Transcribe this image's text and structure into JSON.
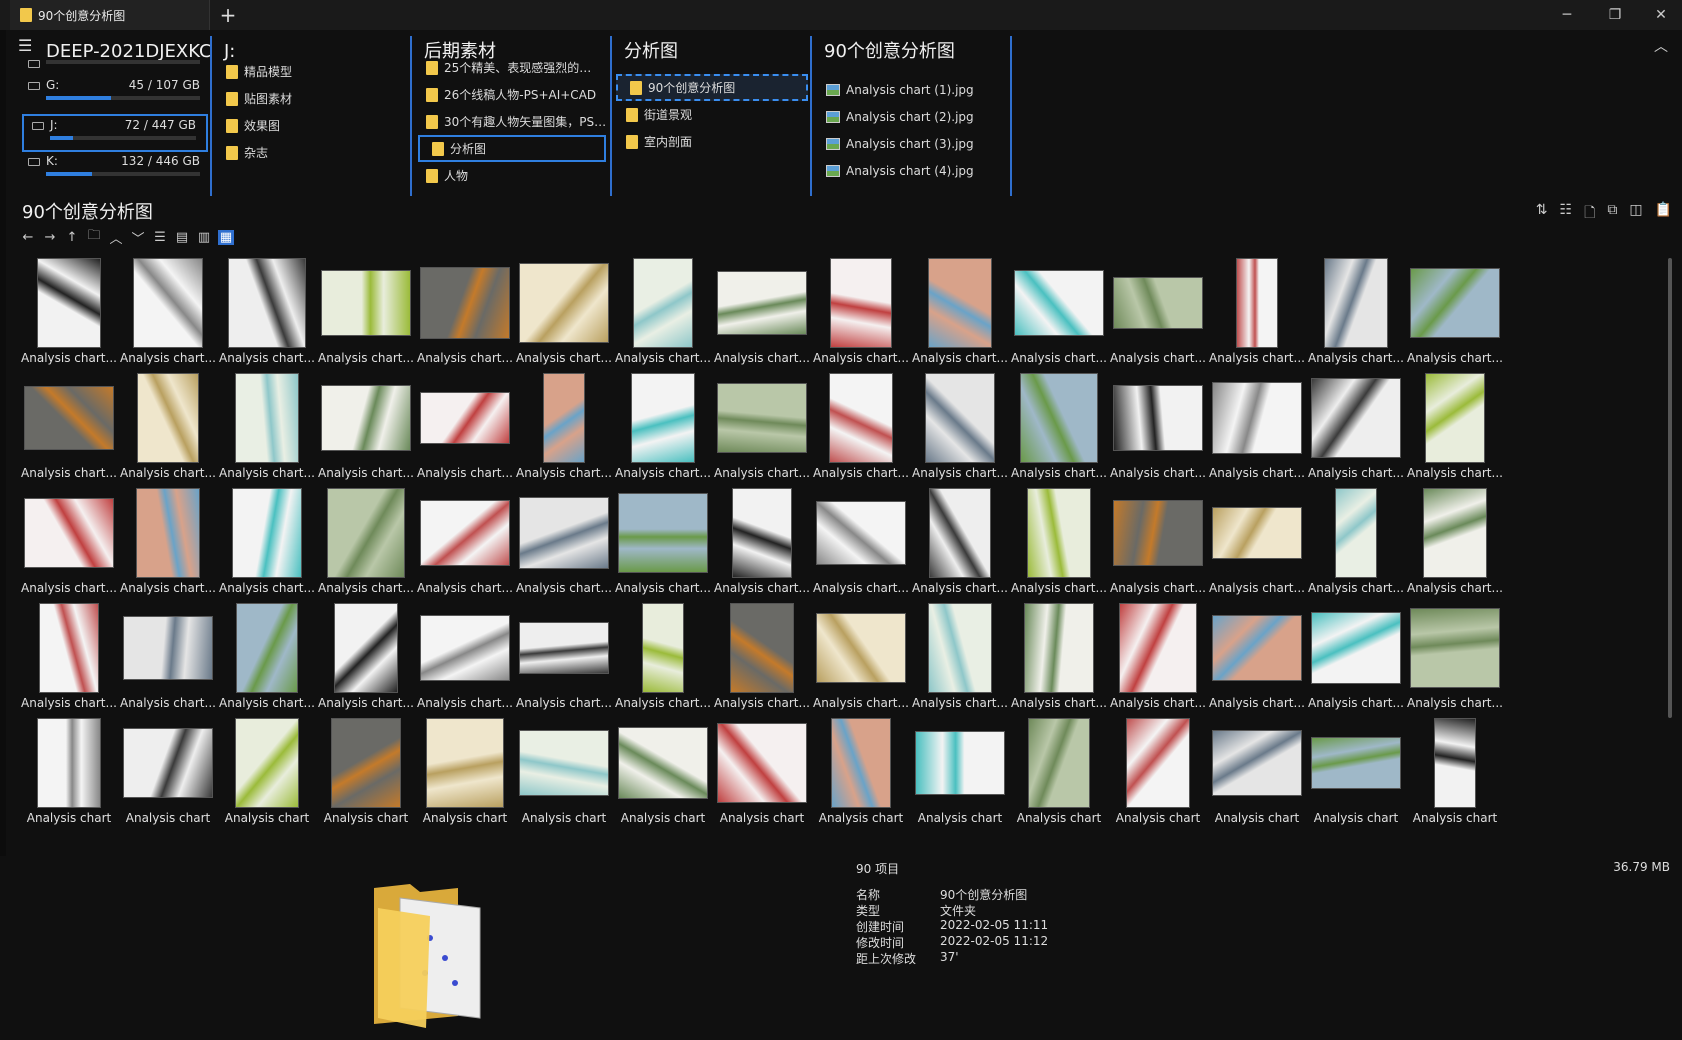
{
  "window": {
    "tab_title": "90个创意分析图",
    "new_tab": "+",
    "minimize": "─",
    "maximize": "❐",
    "close": "✕"
  },
  "columns": {
    "drives_title": "DEEP-2021DJEXKC",
    "drives": [
      {
        "label": "",
        "value": "",
        "fill": 0.0
      },
      {
        "label": "G:",
        "value": "45 / 107 GB",
        "fill": 0.42
      },
      {
        "label": "J:",
        "value": "72 / 447 GB",
        "fill": 0.16,
        "selected": true
      },
      {
        "label": "K:",
        "value": "132 / 446 GB",
        "fill": 0.3
      }
    ],
    "col_j": {
      "title": "J:",
      "items": [
        "精品模型",
        "贴图素材",
        "效果图",
        "杂志"
      ]
    },
    "col_houqi": {
      "title": "后期素材",
      "items": [
        "25个精美、表现感强烈的…",
        "26个线稿人物-PS+AI+CAD",
        "30个有趣人物矢量图集，PS…",
        "分析图",
        "人物"
      ],
      "selected_index": 3
    },
    "col_fenxi": {
      "title": "分析图",
      "items": [
        "90个创意分析图",
        "街道景观",
        "室内剖面"
      ],
      "selected_index": 0
    },
    "col_files": {
      "title": "90个创意分析图",
      "items": [
        "Analysis chart (1).jpg",
        "Analysis chart (2).jpg",
        "Analysis chart (3).jpg",
        "Analysis chart (4).jpg"
      ]
    }
  },
  "path_title": "90个创意分析图",
  "grid": {
    "label": "Analysis chart...",
    "label_partial": "Analysis chart"
  },
  "info": {
    "count": "90 项目",
    "size": "36.79 MB",
    "props": [
      {
        "key": "名称",
        "value": "90个创意分析图"
      },
      {
        "key": "类型",
        "value": "文件夹"
      },
      {
        "key": "创建时间",
        "value": "2022-02-05  11:11"
      },
      {
        "key": "修改时间",
        "value": "2022-02-05  11:12"
      },
      {
        "key": "距上次修改",
        "value": "37'"
      }
    ]
  },
  "colors": {
    "accent": "#2f7fe0",
    "folder": "#f2c84b",
    "background": "#101010"
  }
}
